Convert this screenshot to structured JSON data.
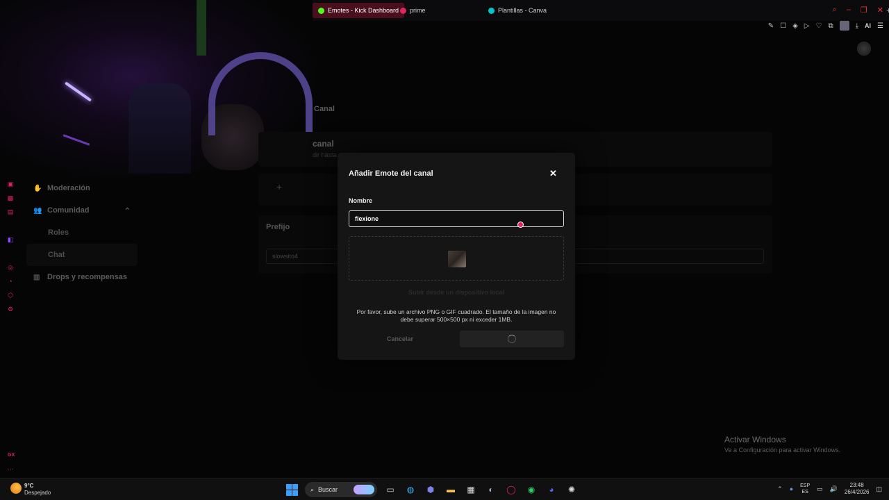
{
  "browser": {
    "tabs": [
      {
        "label": "Emotes - Kick Dashboard",
        "color": "#53fc18"
      },
      {
        "label": "prime",
        "color": "#e0245e"
      },
      {
        "label": "Plantillas - Canva",
        "color": "#00c4cc"
      }
    ],
    "new_tab": "+",
    "ai_label": "AI"
  },
  "sidebar": {
    "items": [
      {
        "label": "Moderación",
        "icon": "hand-icon"
      },
      {
        "label": "Comunidad",
        "icon": "people-icon"
      },
      {
        "label": "Roles"
      },
      {
        "label": "Chat"
      },
      {
        "label": "Drops y recompensas",
        "icon": "gift-icon"
      }
    ]
  },
  "main": {
    "section_title": "Canal",
    "card1_title": "canal",
    "card1_sub": "dir hasta",
    "prefix_title": "Prefijo",
    "prefix_value": "slowsito4"
  },
  "modal": {
    "title": "Añadir Emote del canal",
    "name_label": "Nombre",
    "name_value": "flexione",
    "upload_local": "Subir desde un dispositivo local",
    "hint": "Por favor, sube un archivo PNG o GIF cuadrado. El tamaño de la imagen no debe superar 500×500 px ni exceder 1MB.",
    "cancel": "Cancelar"
  },
  "watermark": {
    "title": "Activar Windows",
    "subtitle": "Ve a Configuración para activar Windows."
  },
  "taskbar": {
    "temperature": "9°C",
    "weather": "Despejado",
    "search": "Buscar",
    "lang_top": "ESP",
    "lang_bottom": "ES",
    "time": "23:48",
    "date": "26/4/2026"
  },
  "rail": {
    "gx_label": "GX",
    "more": "···"
  },
  "colors": {
    "accent": "#e0245e",
    "kick_green": "#53fc18"
  }
}
